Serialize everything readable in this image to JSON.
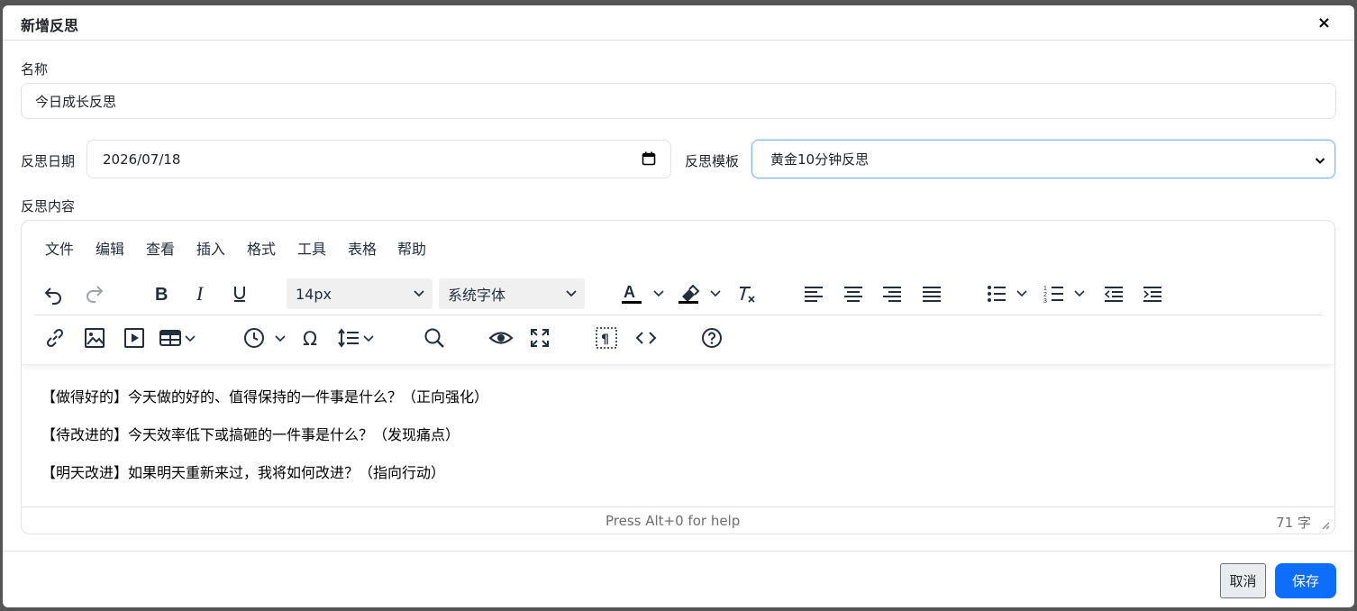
{
  "modal": {
    "title": "新增反思",
    "close": "×"
  },
  "form": {
    "name_label": "名称",
    "name_value": "今日成长反思",
    "date_label": "反思日期",
    "date_value": "2026/07/18",
    "template_label": "反思模板",
    "template_value": "黄金10分钟反思",
    "content_label": "反思内容"
  },
  "editor": {
    "menu": [
      "文件",
      "编辑",
      "查看",
      "插入",
      "格式",
      "工具",
      "表格",
      "帮助"
    ],
    "font_size": "14px",
    "font_family": "系统字体",
    "lines": [
      "【做得好的】今天做的好的、值得保持的一件事是什么？（正向强化）",
      "【待改进的】今天效率低下或搞砸的一件事是什么？（发现痛点）",
      "【明天改进】如果明天重新来过，我将如何改进？（指向行动）"
    ],
    "help_text": "Press Alt+0 for help",
    "word_count": "71 字"
  },
  "footer": {
    "cancel": "取消",
    "save": "保存"
  },
  "colors": {
    "primary": "#0d6efd",
    "focus_border": "#86b7fe"
  }
}
